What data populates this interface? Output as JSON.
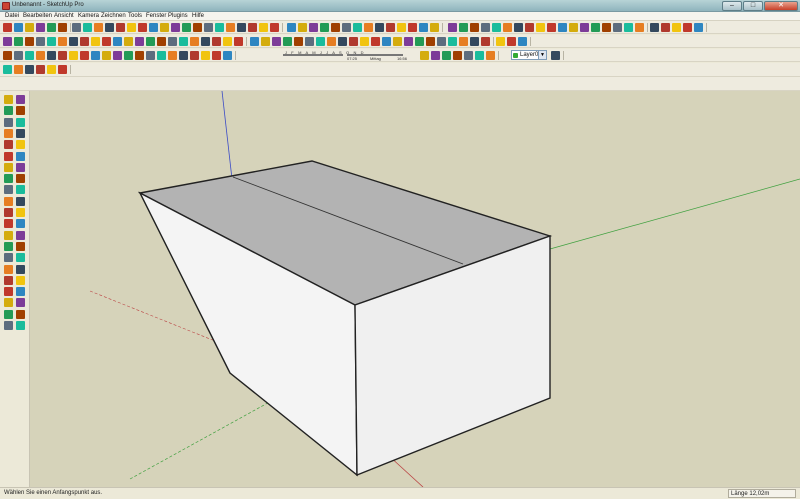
{
  "window": {
    "title": "Unbenannt - SketchUp Pro"
  },
  "menu": [
    {
      "label": "Datei"
    },
    {
      "label": "Bearbeiten"
    },
    {
      "label": "Ansicht"
    },
    {
      "label": "Kamera"
    },
    {
      "label": "Zeichnen"
    },
    {
      "label": "Tools"
    },
    {
      "label": "Fenster"
    },
    {
      "label": "Plugins"
    },
    {
      "label": "Hilfe"
    }
  ],
  "shadow_settings": {
    "months": "J F M A M J J A S O N D",
    "time_start": "07:25",
    "time_noon": "Mittag",
    "time_end": "16:56"
  },
  "layer_select": {
    "value": "Layer0"
  },
  "status": {
    "hint": "Wählen Sie einen Anfangspunkt aus.",
    "measurement_label": "Länge 12,02m"
  },
  "colors": {
    "viewport_background": "#d6d3ba",
    "box_top_face": "#b3b3b3",
    "box_side_face": "#f4f4f4",
    "axis_blue": "#3b4bc6",
    "axis_green": "#3fa03f",
    "axis_red": "#b44",
    "titlebar": "#b7d3d6"
  },
  "model": {
    "object": "box"
  }
}
